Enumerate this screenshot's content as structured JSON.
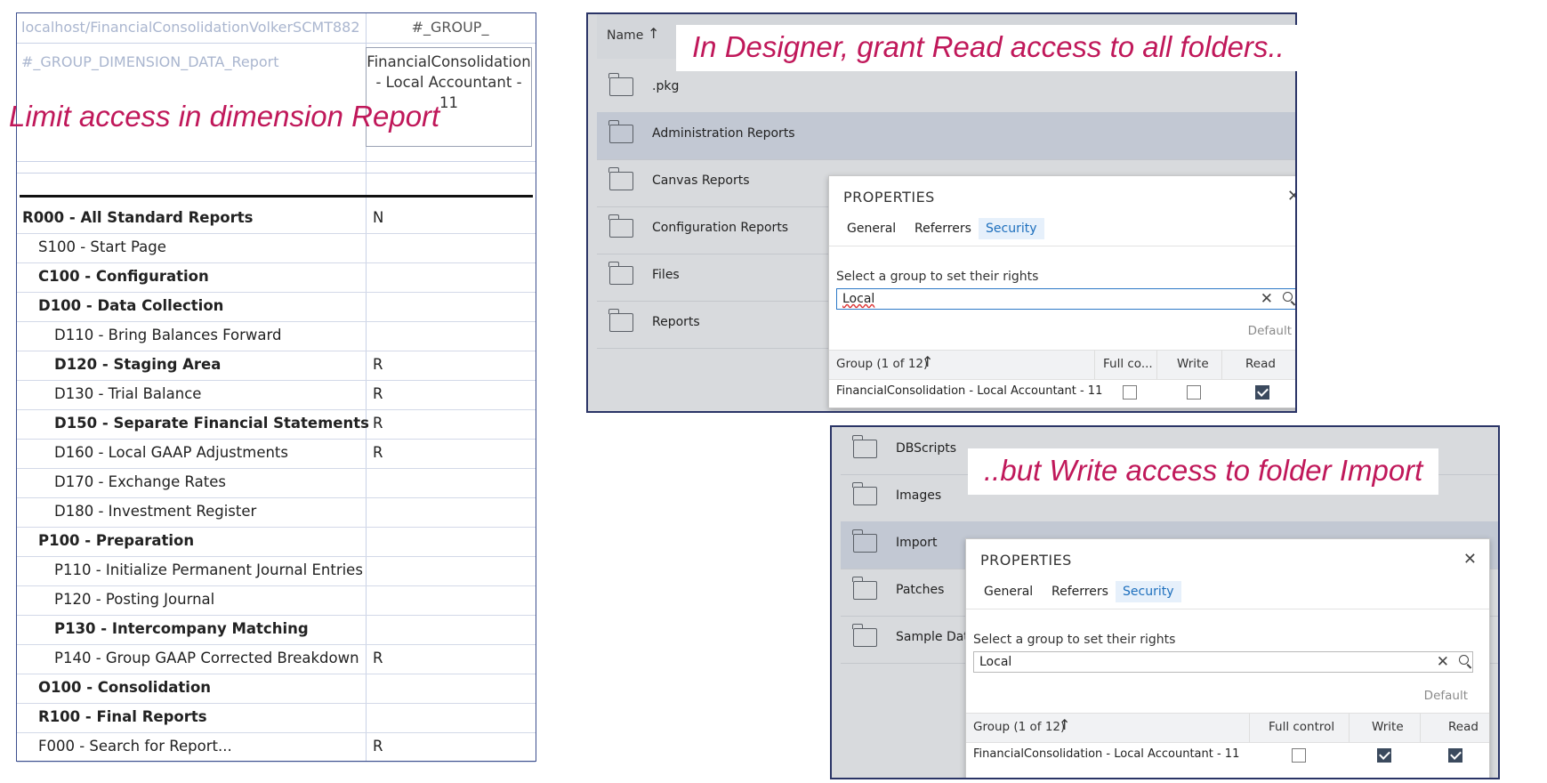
{
  "report": {
    "url": "localhost/FinancialConsolidationVolkerSCMT882",
    "group_header": "#_GROUP_",
    "dimension_header": "#_GROUP_DIMENSION_DATA_Report",
    "group_name": "FinancialConsolidation - Local Accountant - 11",
    "rows": [
      {
        "label": "R000 - All Standard Reports",
        "value": "N",
        "bold": true,
        "level": 0
      },
      {
        "label": "S100 - Start Page",
        "value": "",
        "bold": false,
        "level": 1
      },
      {
        "label": "C100 - Configuration",
        "value": "",
        "bold": true,
        "level": 1
      },
      {
        "label": "D100 - Data Collection",
        "value": "",
        "bold": true,
        "level": 1
      },
      {
        "label": "D110 - Bring Balances Forward",
        "value": "",
        "bold": false,
        "level": 2
      },
      {
        "label": "D120 - Staging Area",
        "value": "R",
        "bold": true,
        "level": 2
      },
      {
        "label": "D130 - Trial Balance",
        "value": "R",
        "bold": false,
        "level": 2
      },
      {
        "label": "D150 - Separate Financial Statements",
        "value": "R",
        "bold": true,
        "level": 2
      },
      {
        "label": "D160 - Local GAAP Adjustments",
        "value": "R",
        "bold": false,
        "level": 2
      },
      {
        "label": "D170 - Exchange Rates",
        "value": "",
        "bold": false,
        "level": 2
      },
      {
        "label": "D180 - Investment Register",
        "value": "",
        "bold": false,
        "level": 2
      },
      {
        "label": "P100 - Preparation",
        "value": "",
        "bold": true,
        "level": 1
      },
      {
        "label": "P110 - Initialize Permanent Journal Entries",
        "value": "",
        "bold": false,
        "level": 2
      },
      {
        "label": "P120 - Posting Journal",
        "value": "",
        "bold": false,
        "level": 2
      },
      {
        "label": "P130 - Intercompany Matching",
        "value": "",
        "bold": true,
        "level": 2
      },
      {
        "label": "P140 - Group GAAP Corrected Breakdown",
        "value": "R",
        "bold": false,
        "level": 2
      },
      {
        "label": "O100 - Consolidation",
        "value": "",
        "bold": true,
        "level": 1
      },
      {
        "label": "R100 - Final Reports",
        "value": "",
        "bold": true,
        "level": 1
      },
      {
        "label": "F000 - Search for Report...",
        "value": "R",
        "bold": false,
        "level": 1
      }
    ]
  },
  "callouts": {
    "limit": "Limit access in dimension Report",
    "read": "In Designer, grant Read access to all folders..",
    "write": "..but Write access to folder Import"
  },
  "designer_top": {
    "column_header": "Name",
    "folders": [
      ".pkg",
      "Administration Reports",
      "Canvas Reports",
      "Configuration Reports",
      "Files",
      "Reports"
    ],
    "selected_index": 1,
    "properties": {
      "title": "PROPERTIES",
      "tabs": [
        "General",
        "Referrers",
        "Security"
      ],
      "active_tab": "Security",
      "search_label": "Select a group to set their rights",
      "search_value": "Local",
      "default_label": "Default",
      "columns": [
        "Group (1 of 12)",
        "Full co...",
        "Write",
        "Read"
      ],
      "row": {
        "group": "FinancialConsolidation - Local Accountant - 11",
        "full_control": false,
        "write": false,
        "read": true
      }
    }
  },
  "designer_bottom": {
    "folders": [
      "DBScripts",
      "Images",
      "Import",
      "Patches",
      "Sample Data"
    ],
    "selected_index": 2,
    "properties": {
      "title": "PROPERTIES",
      "tabs": [
        "General",
        "Referrers",
        "Security"
      ],
      "active_tab": "Security",
      "search_label": "Select a group to set their rights",
      "search_value": "Local",
      "default_label": "Default",
      "columns": [
        "Group (1 of 12)",
        "Full control",
        "Write",
        "Read"
      ],
      "row": {
        "group": "FinancialConsolidation - Local Accountant - 11",
        "full_control": false,
        "write": true,
        "read": true
      }
    }
  }
}
